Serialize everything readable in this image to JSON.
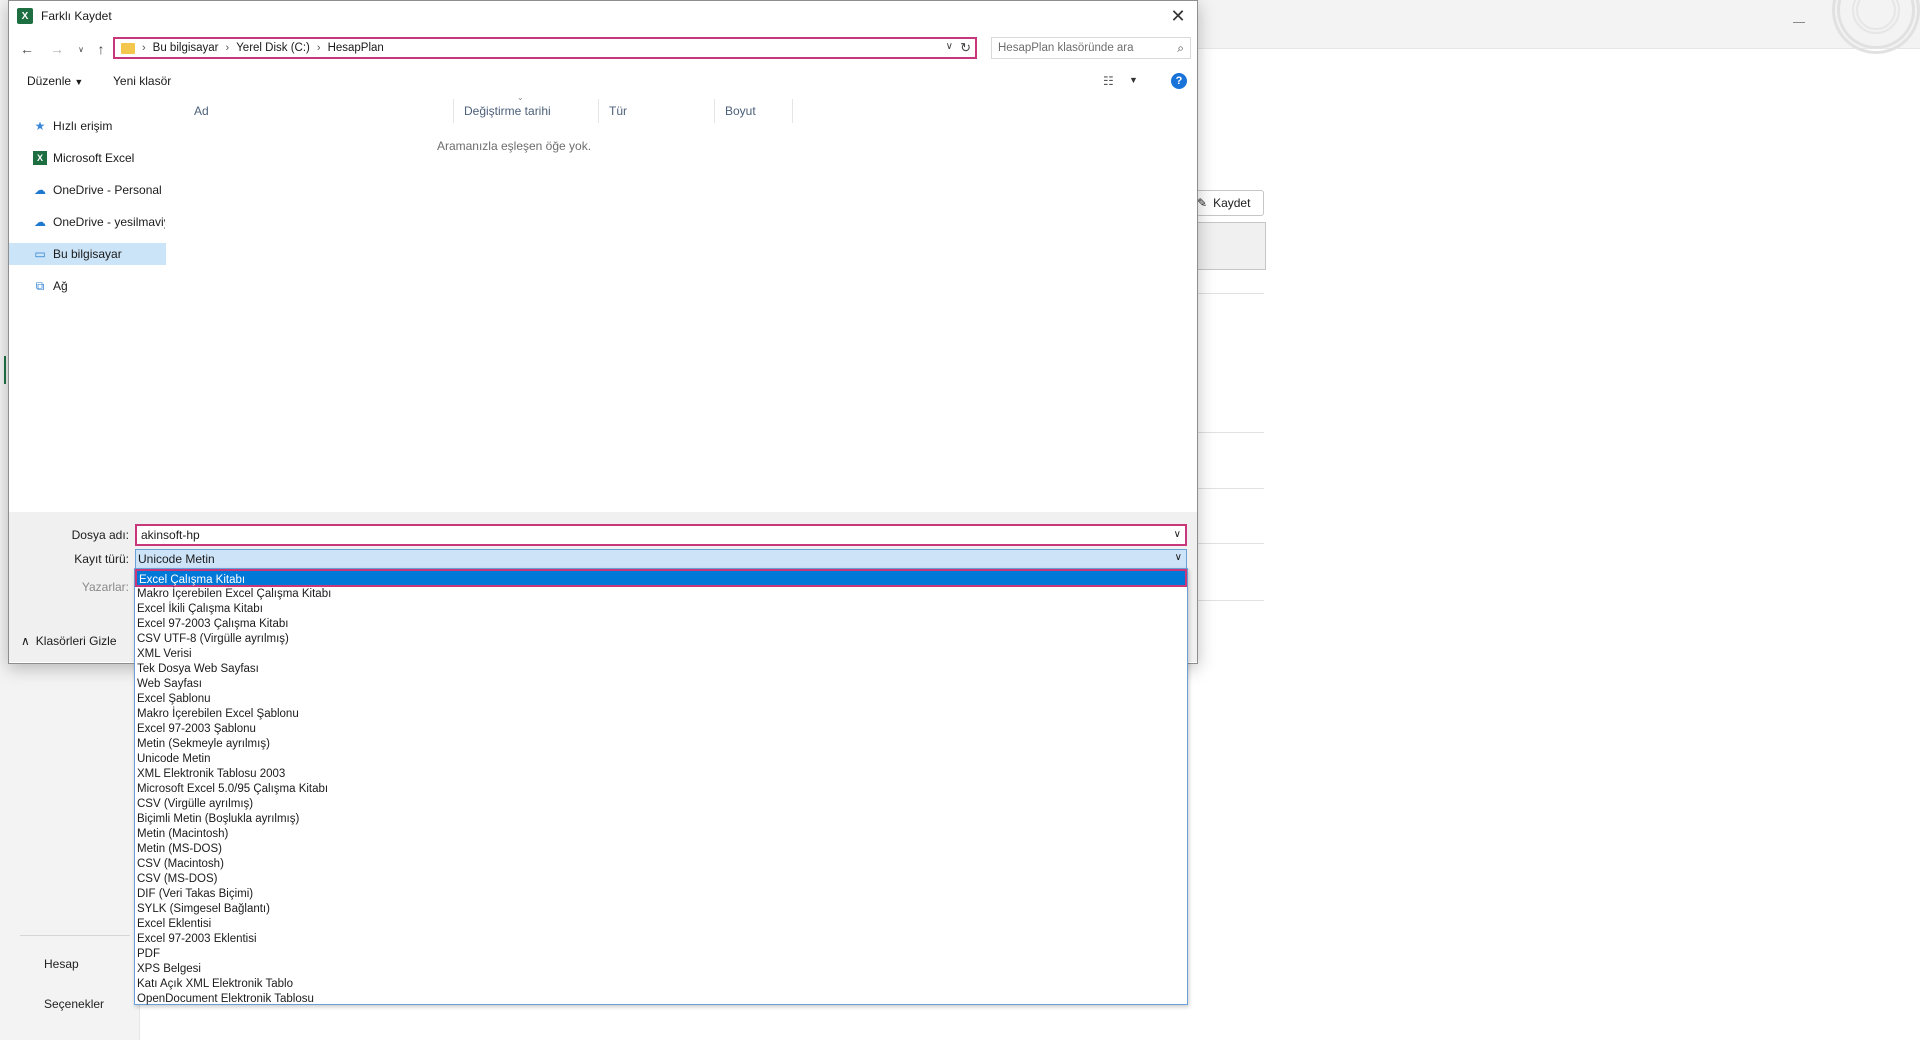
{
  "dialog": {
    "title": "Farklı Kaydet",
    "close_icon": "close-icon"
  },
  "nav": {
    "breadcrumb": [
      "Bu bilgisayar",
      "Yerel Disk (C:)",
      "HesapPlan"
    ],
    "search_placeholder": "HesapPlan klasöründe ara"
  },
  "toolbar": {
    "organize": "Düzenle",
    "new_folder": "Yeni klasör"
  },
  "sidebar": {
    "items": [
      {
        "label": "Hızlı erişim",
        "icon": "star-icon"
      },
      {
        "label": "Microsoft Excel",
        "icon": "excel-icon"
      },
      {
        "label": "OneDrive - Personal",
        "icon": "cloud-icon"
      },
      {
        "label": "OneDrive - yesilmaviyazilim",
        "icon": "cloud-icon"
      },
      {
        "label": "Bu bilgisayar",
        "icon": "computer-icon"
      },
      {
        "label": "Ağ",
        "icon": "network-icon"
      }
    ]
  },
  "file_list": {
    "columns": [
      "Ad",
      "Değiştirme tarihi",
      "Tür",
      "Boyut"
    ],
    "empty_message": "Aramanızla eşleşen öğe yok."
  },
  "form": {
    "filename_label": "Dosya adı:",
    "filename_value": "akinsoft-hp",
    "filetype_label": "Kayıt türü:",
    "filetype_value": "Unicode Metin",
    "authors_label": "Yazarlar:",
    "hide_folders": "Klasörleri Gizle"
  },
  "filetype_options": [
    "Excel Çalışma Kitabı",
    "Makro İçerebilen Excel Çalışma Kitabı",
    "Excel İkili Çalışma Kitabı",
    "Excel 97-2003 Çalışma Kitabı",
    "CSV UTF-8 (Virgülle ayrılmış)",
    "XML Verisi",
    "Tek Dosya Web Sayfası",
    "Web Sayfası",
    "Excel Şablonu",
    "Makro İçerebilen Excel Şablonu",
    "Excel 97-2003 Şablonu",
    "Metin (Sekmeyle ayrılmış)",
    "Unicode Metin",
    "XML Elektronik Tablosu 2003",
    "Microsoft Excel 5.0/95 Çalışma Kitabı",
    "CSV (Virgülle ayrılmış)",
    "Biçimli Metin (Boşlukla ayrılmış)",
    "Metin (Macintosh)",
    "Metin (MS-DOS)",
    "CSV (Macintosh)",
    "CSV (MS-DOS)",
    "DIF (Veri Takas Biçimi)",
    "SYLK (Simgesel Bağlantı)",
    "Excel Eklentisi",
    "Excel 97-2003 Eklentisi",
    "PDF",
    "XPS Belgesi",
    "Katı Açık XML Elektronik Tablo",
    "OpenDocument Elektronik Tablosu"
  ],
  "background": {
    "save_button": "Kaydet",
    "nav_account": "Hesap",
    "nav_options": "Seçenekler"
  }
}
